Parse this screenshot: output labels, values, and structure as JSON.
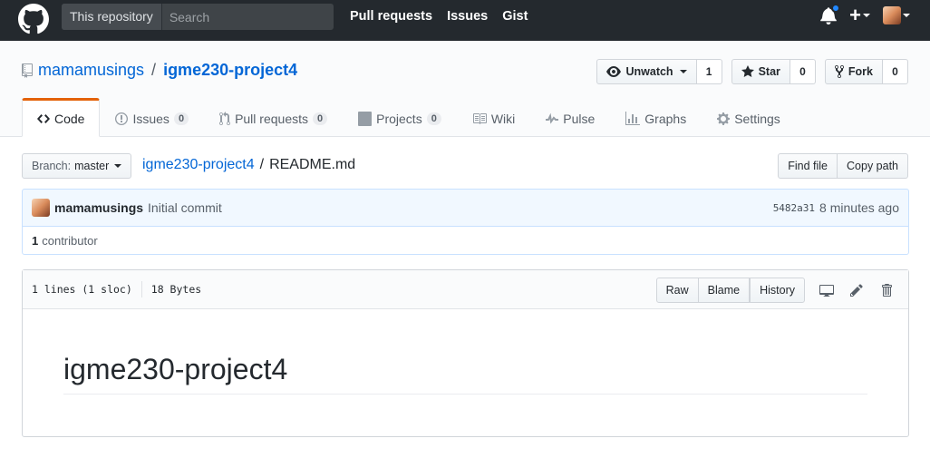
{
  "header": {
    "search_scope": "This repository",
    "search_placeholder": "Search",
    "nav": [
      "Pull requests",
      "Issues",
      "Gist"
    ],
    "has_notification": true
  },
  "repo": {
    "owner": "mamamusings",
    "separator": "/",
    "name": "igme230-project4",
    "actions": {
      "watch_label": "Unwatch",
      "watch_count": "1",
      "star_label": "Star",
      "star_count": "0",
      "fork_label": "Fork",
      "fork_count": "0"
    },
    "tabs": [
      {
        "label": "Code",
        "icon": "code-icon",
        "selected": true
      },
      {
        "label": "Issues",
        "icon": "issue-icon",
        "count": "0"
      },
      {
        "label": "Pull requests",
        "icon": "pull-request-icon",
        "count": "0"
      },
      {
        "label": "Projects",
        "icon": "project-icon",
        "count": "0"
      },
      {
        "label": "Wiki",
        "icon": "book-icon"
      },
      {
        "label": "Pulse",
        "icon": "pulse-icon"
      },
      {
        "label": "Graphs",
        "icon": "graph-icon"
      },
      {
        "label": "Settings",
        "icon": "gear-icon"
      }
    ]
  },
  "filenav": {
    "branch_label": "Branch:",
    "branch_value": "master",
    "breadcrumb_repo": "igme230-project4",
    "breadcrumb_sep": "/",
    "breadcrumb_file": "README.md",
    "find_file": "Find file",
    "copy_path": "Copy path"
  },
  "commit": {
    "author": "mamamusings",
    "message": "Initial commit",
    "sha": "5482a31",
    "time": "8 minutes ago",
    "contributors_count": "1",
    "contributors_label": "contributor"
  },
  "file": {
    "lines": "1 lines (1 sloc)",
    "size": "18 Bytes",
    "raw": "Raw",
    "blame": "Blame",
    "history": "History",
    "readme_heading": "igme230-project4"
  },
  "colors": {
    "header_bg": "#24292e",
    "link": "#0366d6",
    "tab_accent": "#e36209",
    "commit_bg": "#f1f8ff",
    "notification": "#2188ff"
  }
}
